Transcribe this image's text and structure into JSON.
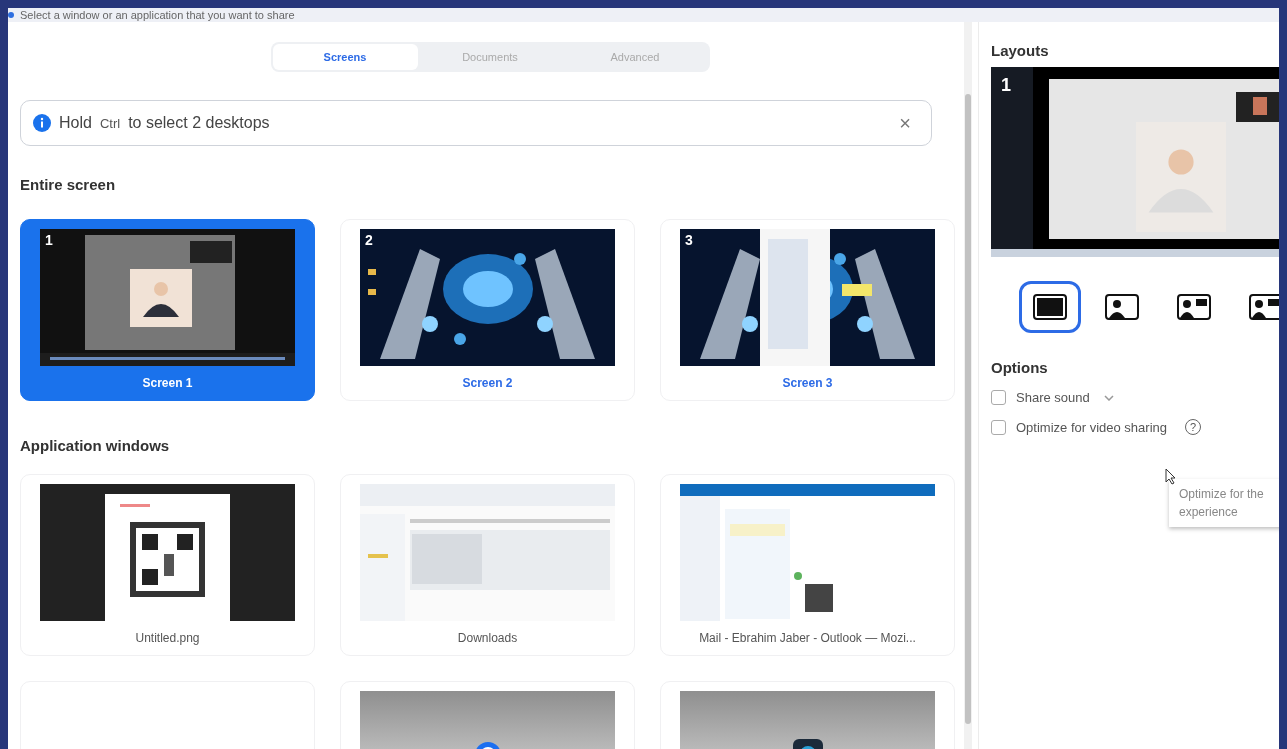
{
  "window": {
    "title": "Select a window or an application that you want to share"
  },
  "tabs": [
    {
      "label": "Screens",
      "selected": true
    },
    {
      "label": "Documents",
      "selected": false
    },
    {
      "label": "Advanced",
      "selected": false
    }
  ],
  "banner": {
    "before": "Hold",
    "key": "Ctrl",
    "after": "to select 2 desktops",
    "close": "×"
  },
  "entire_screen": {
    "heading": "Entire screen",
    "items": [
      {
        "number": "1",
        "label": "Screen 1",
        "selected": true
      },
      {
        "number": "2",
        "label": "Screen 2",
        "selected": false
      },
      {
        "number": "3",
        "label": "Screen 3",
        "selected": false
      }
    ]
  },
  "application_windows": {
    "heading": "Application windows",
    "items": [
      {
        "label": "Untitled.png",
        "selected": false
      },
      {
        "label": "Downloads",
        "selected": false
      },
      {
        "label": "Mail - Ebrahim Jaber - Outlook — Mozi...",
        "selected": false
      },
      {
        "selected": false
      },
      {
        "selected": false
      },
      {
        "selected": false
      }
    ]
  },
  "layouts": {
    "heading": "Layouts",
    "preview_number": "1",
    "items": [
      {
        "kind": "screen",
        "selected": true
      },
      {
        "kind": "camera",
        "selected": false
      },
      {
        "kind": "side-by-side",
        "selected": false
      },
      {
        "kind": "side-by-side",
        "selected": false
      }
    ]
  },
  "options": {
    "heading": "Options",
    "items": [
      {
        "kind": "dropdown",
        "label": "Share sound",
        "checked": false
      },
      {
        "kind": "help",
        "label": "Optimize for video sharing",
        "checked": false,
        "help": "?"
      }
    ],
    "tooltip": [
      "Optimize for the",
      "experience"
    ]
  }
}
